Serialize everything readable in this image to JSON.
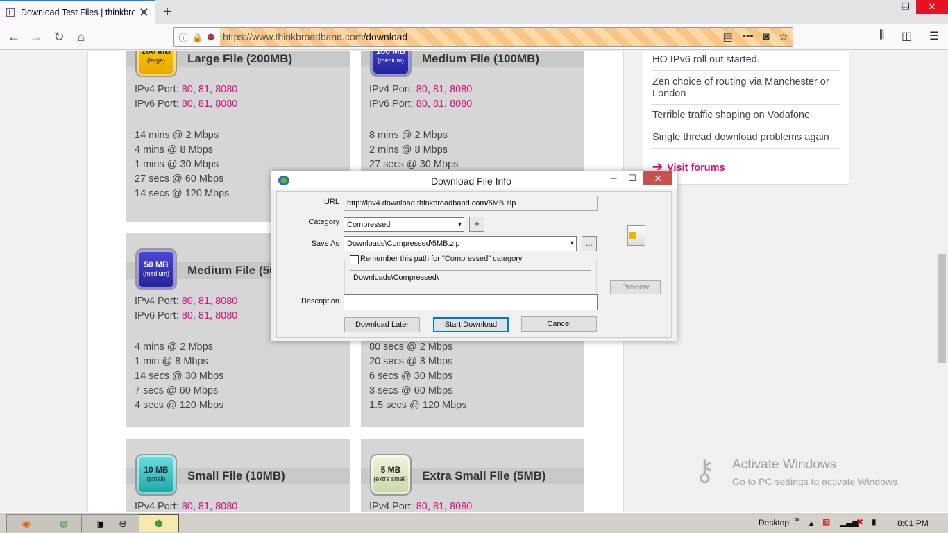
{
  "browser": {
    "tab_title": "Download Test Files | thinkbroa",
    "url_domain": "https://www.thinkbroadband.com",
    "url_path": "/download"
  },
  "cards": [
    {
      "badge_size": "200 MB",
      "badge_class": "(large)",
      "name": "Large File (200MB)",
      "ipv4_label": "IPv4 Port:",
      "ipv6_label": "IPv6 Port:",
      "ports": [
        "80",
        "81",
        "8080"
      ],
      "times": [
        "14 mins @ 2 Mbps",
        "4 mins @ 8 Mbps",
        "1 mins @ 30 Mbps",
        "27 secs @ 60 Mbps",
        "14 secs @ 120 Mbps"
      ]
    },
    {
      "badge_size": "100 MB",
      "badge_class": "(medium)",
      "name": "Medium File (100MB)",
      "ipv4_label": "IPv4 Port:",
      "ipv6_label": "IPv6 Port:",
      "ports": [
        "80",
        "81",
        "8080"
      ],
      "times": [
        "8 mins @ 2 Mbps",
        "2 mins @ 8 Mbps",
        "27 secs @ 30 Mbps"
      ]
    },
    {
      "badge_size": "50 MB",
      "badge_class": "(medium)",
      "name": "Medium File (50MB)",
      "ipv4_label": "IPv4 Port:",
      "ipv6_label": "IPv6 Port:",
      "ports": [
        "80",
        "81",
        "8080"
      ],
      "times": [
        "4 mins @ 2 Mbps",
        "1 min @ 8 Mbps",
        "14 secs @ 30 Mbps",
        "7 secs @ 60 Mbps",
        "4 secs @ 120 Mbps"
      ]
    },
    {
      "times": [
        "80 secs @ 2 Mbps",
        "20 secs @ 8 Mbps",
        "6 secs @ 30 Mbps",
        "3 secs @ 60 Mbps",
        "1.5 secs @ 120 Mbps"
      ]
    },
    {
      "badge_size": "10 MB",
      "badge_class": "(small)",
      "name": "Small File (10MB)",
      "ipv4_label": "IPv4 Port:",
      "ports": [
        "80",
        "81",
        "8080"
      ]
    },
    {
      "badge_size": "5 MB",
      "badge_class": "(extra small)",
      "name": "Extra Small File (5MB)",
      "ipv4_label": "IPv4 Port:",
      "ports": [
        "80",
        "81",
        "8080"
      ]
    }
  ],
  "sidebar": {
    "items": [
      "HO IPv6 roll out started.",
      "Zen choice of routing via Manchester or London",
      "Terrible traffic shaping on Vodafone",
      "Single thread download problems again"
    ],
    "visit_forums": "Visit forums"
  },
  "watermark": {
    "line1": "Activate Windows",
    "line2": "Go to PC settings to activate Windows."
  },
  "dialog": {
    "title": "Download File Info",
    "url_label": "URL",
    "url_value": "http://ipv4.download.thinkbroadband.com/5MB.zip",
    "category_label": "Category",
    "category_value": "Compressed",
    "add_label": "+",
    "saveas_label": "Save As",
    "saveas_value": "Downloads\\Compressed\\5MB.zip",
    "browse_label": "...",
    "remember_label": "Remember this path for \"Compressed\" category",
    "remember_path": "Downloads\\Compressed\\",
    "preview_label": "Preview",
    "description_label": "Description",
    "description_value": "",
    "download_later": "Download Later",
    "start_download": "Start Download",
    "cancel": "Cancel"
  },
  "taskbar": {
    "desktop": "Desktop",
    "chevron": "»",
    "time": "8:01 PM"
  }
}
